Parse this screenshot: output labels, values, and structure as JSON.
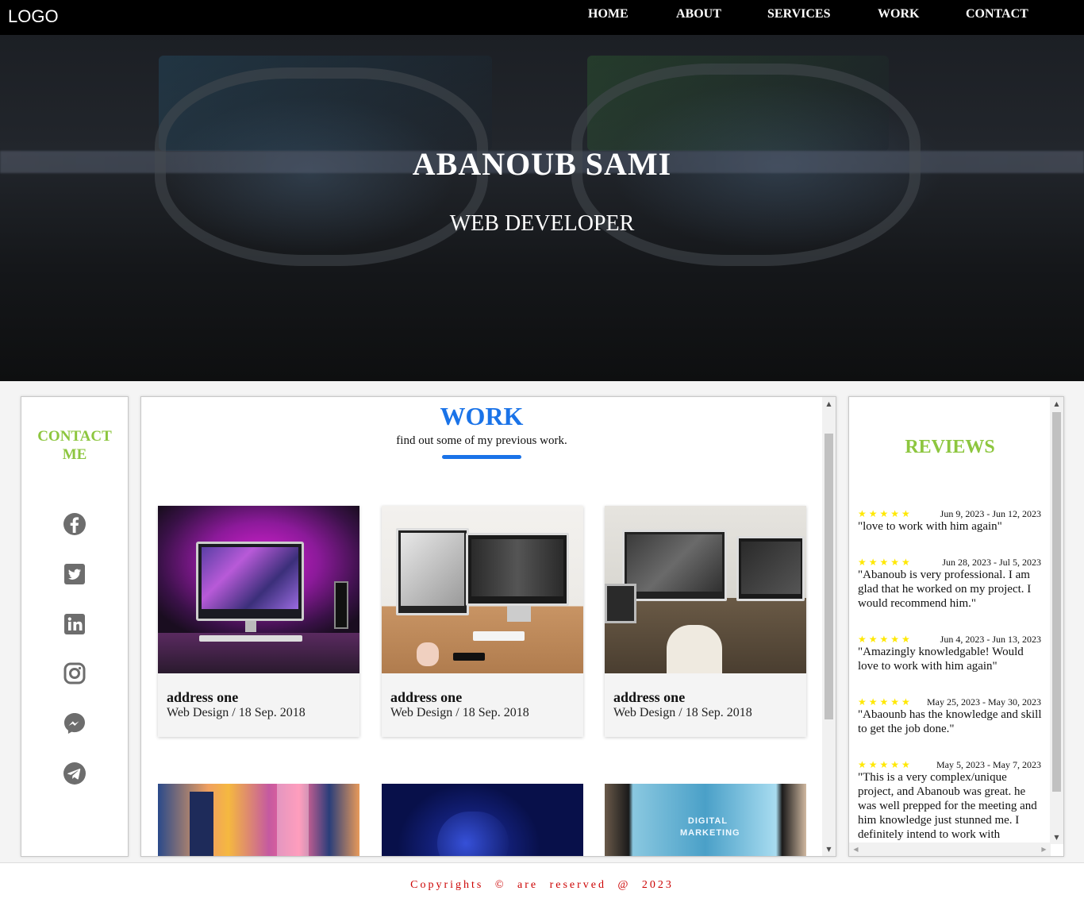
{
  "nav": {
    "logo": "LOGO",
    "links": [
      "HOME",
      "ABOUT",
      "SERVICES",
      "WORK",
      "CONTACT"
    ]
  },
  "hero": {
    "name": "ABANOUB SAMI",
    "role": "WEB DEVELOPER"
  },
  "contact": {
    "title_line1": "CONTACT",
    "title_line2": "ME",
    "socials": [
      "facebook-icon",
      "twitter-icon",
      "linkedin-icon",
      "instagram-icon",
      "messenger-icon",
      "telegram-icon"
    ]
  },
  "work": {
    "title": "WORK",
    "subtitle": "find out some of my previous work.",
    "cards": [
      {
        "name": "address one",
        "meta": "Web Design / 18 Sep. 2018"
      },
      {
        "name": "address one",
        "meta": "Web Design / 18 Sep. 2018"
      },
      {
        "name": "address one",
        "meta": "Web Design / 18 Sep. 2018"
      }
    ],
    "second_row_image_text": "DIGITAL MARKETING"
  },
  "reviews": {
    "title": "REVIEWS",
    "stars": "★★★★★",
    "items": [
      {
        "date": "Jun 9, 2023 - Jun 12, 2023",
        "text": "\"love to work with him again\""
      },
      {
        "date": "Jun 28, 2023 - Jul 5, 2023",
        "text": "\"Abanoub is very professional. I am glad that he worked on my project. I would recommend him.\""
      },
      {
        "date": "Jun 4, 2023 - Jun 13, 2023",
        "text": "\"Amazingly knowledgable! Would love to work with him again\""
      },
      {
        "date": "May 25, 2023 - May 30, 2023",
        "text": "\"Abaounb has the knowledge and skill to get the job done.\""
      },
      {
        "date": "May 5, 2023 - May 7, 2023",
        "text": "\"This is a very complex/unique project, and Abanoub was great. he was well prepped for the meeting and him knowledge just stunned me. I definitely intend to work with"
      }
    ]
  },
  "footer": {
    "text": "Copyrights © are reserved @ 2023"
  },
  "colors": {
    "accent_blue": "#1a73e8",
    "accent_green": "#8dc63f",
    "footer_red": "#cc0000",
    "star_yellow": "#ffe800"
  }
}
